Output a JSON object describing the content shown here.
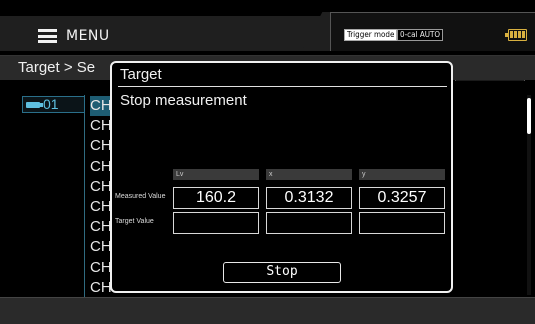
{
  "header": {
    "menu_label": "MENU",
    "trigger_badge": "Trigger mode",
    "ocal_badge": "0-cal AUTO"
  },
  "breadcrumb": "Target > Se",
  "list": {
    "selected_item": "01",
    "channels": [
      "CH",
      "CH",
      "CH",
      "CH",
      "CH",
      "CH",
      "CH",
      "CH",
      "CH",
      "CH"
    ]
  },
  "dialog": {
    "title": "Target",
    "message": "Stop measurement",
    "columns": [
      "Lv",
      "x",
      "y"
    ],
    "rows": {
      "measured_label": "Measured Value",
      "target_label": "Target Value"
    },
    "measured": {
      "lv": "160.2",
      "x": "0.3132",
      "y": "0.3257"
    },
    "target": {
      "lv": "",
      "x": "",
      "y": ""
    },
    "stop_label": "Stop"
  },
  "colors": {
    "accent": "#1e5d73",
    "selected_text": "#5fc0e0",
    "battery": "#d8b040"
  }
}
